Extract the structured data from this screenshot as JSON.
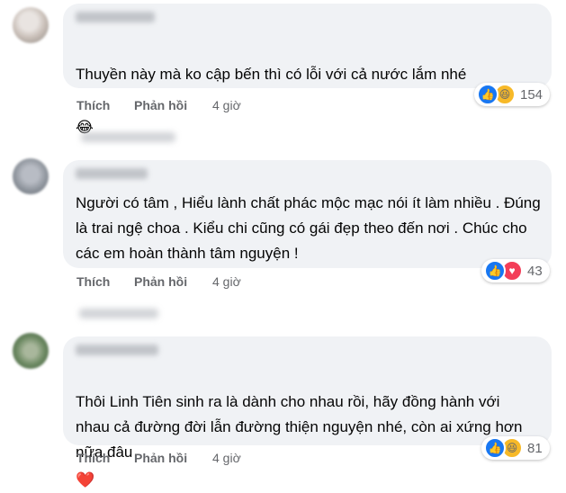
{
  "comments": [
    {
      "text": "Thuyền này mà ko cập bến thì có lỗi với cả nước lắm nhé",
      "emoji": "😂",
      "actions": {
        "like": "Thích",
        "reply": "Phản hồi",
        "time": "4 giờ"
      },
      "reactions": {
        "icons": [
          "like-icon",
          "haha-icon"
        ],
        "count": "154"
      }
    },
    {
      "text": "Người có tâm , Hiểu lành chất phác mộc mạc nói ít làm nhiều . Đúng là trai ngệ choa . Kiểu chi cũng có gái đẹp theo đến nơi . Chúc cho các em hoàn thành tâm nguyện !",
      "actions": {
        "like": "Thích",
        "reply": "Phản hồi",
        "time": "4 giờ"
      },
      "reactions": {
        "icons": [
          "like-icon",
          "love-icon"
        ],
        "count": "43"
      }
    },
    {
      "text": "Thôi Linh Tiên sinh ra là dành cho nhau rồi, hãy đồng hành với nhau cả đường đời lẫn đường thiện nguyện nhé, còn ai xứng hơn nữa đâu",
      "emoji": "❤️",
      "actions": {
        "like": "Thích",
        "reply": "Phản hồi",
        "time": "4 giờ"
      },
      "reactions": {
        "icons": [
          "like-icon",
          "haha-icon"
        ],
        "count": "81"
      }
    }
  ],
  "colors": {
    "bubble": "#f0f2f5",
    "meta": "#65676b",
    "like": "#1877f2",
    "haha": "#f7b928",
    "love": "#f33e58"
  }
}
